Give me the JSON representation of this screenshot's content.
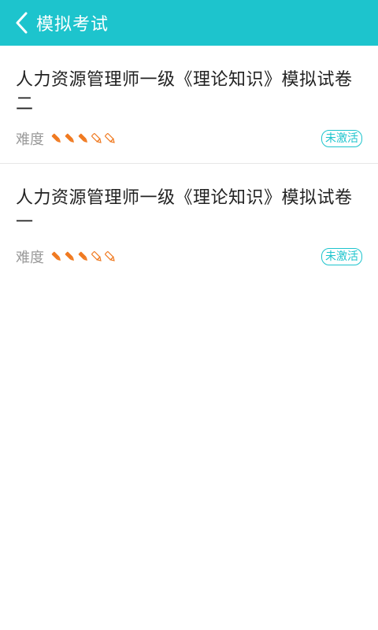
{
  "header": {
    "title": "模拟考试",
    "back_icon": "chevron-left-icon",
    "color": "#1dc4cd"
  },
  "items": [
    {
      "title": "人力资源管理师一级《理论知识》模拟试卷二",
      "difficulty_label": "难度",
      "difficulty": 3,
      "difficulty_max": 5,
      "badge": "未激活"
    },
    {
      "title": "人力资源管理师一级《理论知识》模拟试卷一",
      "difficulty_label": "难度",
      "difficulty": 3,
      "difficulty_max": 5,
      "badge": "未激活"
    }
  ],
  "colors": {
    "pencil_filled": "#f07a21",
    "pencil_empty": "#f07a21",
    "badge": "#1dc4cd"
  }
}
